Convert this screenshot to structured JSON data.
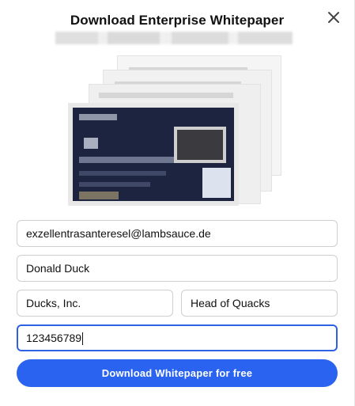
{
  "modal": {
    "title": "Download Enterprise Whitepaper",
    "close_icon": "close-icon"
  },
  "form": {
    "email": "exzellentrasanteresel@lambsauce.de",
    "name": "Donald Duck",
    "company": "Ducks, Inc.",
    "role": "Head of Quacks",
    "phone": "123456789",
    "submit_label": "Download Whitepaper for free"
  },
  "colors": {
    "accent": "#2a63ef",
    "focus_border": "#2e62e5",
    "cover_background": "#1c2440"
  }
}
